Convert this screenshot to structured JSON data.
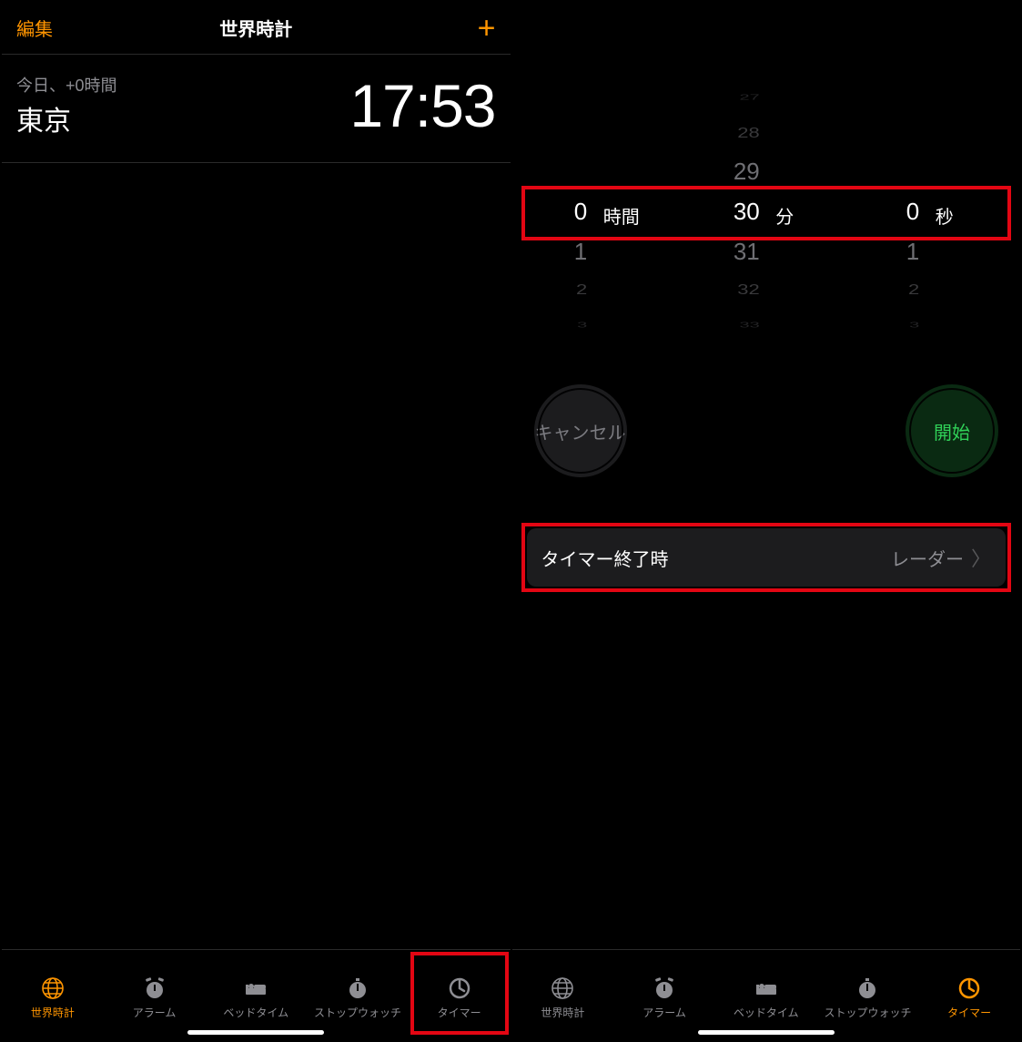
{
  "left": {
    "nav": {
      "edit": "編集",
      "title": "世界時計",
      "add": "+"
    },
    "worldclock": {
      "relative": "今日、+0時間",
      "city": "東京",
      "time": "17:53"
    },
    "tabs": {
      "worldclock": "世界時計",
      "alarm": "アラーム",
      "bedtime": "ベッドタイム",
      "stopwatch": "ストップウォッチ",
      "timer": "タイマー"
    }
  },
  "right": {
    "picker": {
      "hours": {
        "unit": "時間",
        "selected": "0",
        "below1": "1",
        "below2": "2",
        "below3": "3"
      },
      "mins": {
        "unit": "分",
        "above3": "27",
        "above2": "28",
        "above1": "29",
        "selected": "30",
        "below1": "31",
        "below2": "32",
        "below3": "33"
      },
      "secs": {
        "unit": "秒",
        "selected": "0",
        "below1": "1",
        "below2": "2",
        "below3": "3"
      }
    },
    "buttons": {
      "cancel": "キャンセル",
      "start": "開始"
    },
    "endrow": {
      "label": "タイマー終了時",
      "value": "レーダー"
    },
    "tabs": {
      "worldclock": "世界時計",
      "alarm": "アラーム",
      "bedtime": "ベッドタイム",
      "stopwatch": "ストップウォッチ",
      "timer": "タイマー"
    }
  }
}
